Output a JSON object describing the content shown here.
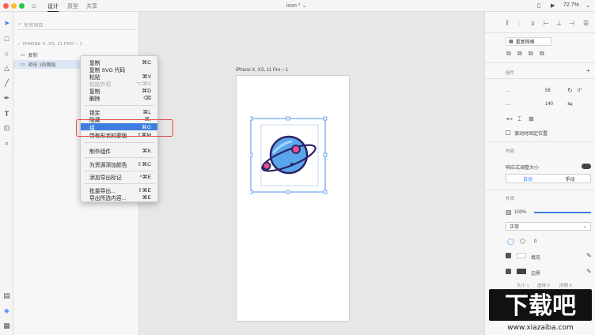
{
  "title_bar": {
    "tabs": [
      "设计",
      "原型",
      "共享"
    ],
    "doc_title": "icon *",
    "zoom": "72.7%"
  },
  "layers": {
    "search_placeholder": "所有项目",
    "artboard_name": "IPHONE X, XS, 11 PRO – 1",
    "items": [
      "复制",
      "矩形 1的图层"
    ]
  },
  "canvas": {
    "artboard_label": "iPhone X, XS, 11 Pro – 1"
  },
  "context_menu": {
    "items": [
      {
        "label": "复制",
        "shortcut": "⌘C",
        "state": "normal"
      },
      {
        "label": "复制 SVG 代码",
        "shortcut": "",
        "state": "normal"
      },
      {
        "label": "粘贴",
        "shortcut": "⌘V",
        "state": "normal"
      },
      {
        "label": "粘贴外观",
        "shortcut": "⌥⌘V",
        "state": "disabled"
      },
      {
        "label": "复制",
        "shortcut": "⌘D",
        "state": "normal"
      },
      {
        "label": "删除",
        "shortcut": "⌫",
        "state": "normal"
      },
      {
        "label": "锁定",
        "shortcut": "⌘L",
        "state": "normal"
      },
      {
        "label": "隐藏",
        "shortcut": "⌘,",
        "state": "normal"
      },
      {
        "label": "组",
        "shortcut": "⌘G",
        "state": "highlighted"
      },
      {
        "label": "带有形状的蒙版",
        "shortcut": "⇧⌘M",
        "state": "normal"
      },
      {
        "label": "制作组件",
        "shortcut": "⌘K",
        "state": "normal"
      },
      {
        "label": "为资源添加颜色",
        "shortcut": "⇧⌘C",
        "state": "normal"
      },
      {
        "label": "添加导出标记",
        "shortcut": "^⌘E",
        "state": "normal"
      },
      {
        "label": "批量导出...",
        "shortcut": "⇧⌘E",
        "state": "normal"
      },
      {
        "label": "导出所选内容...",
        "shortcut": "⌘E",
        "state": "normal"
      }
    ]
  },
  "right_panel": {
    "repeat_grid": "重复网格",
    "components_label": "组件",
    "w": "58",
    "h": "140",
    "rotation": "0°",
    "scroll_fixed": "滚动时固定位置",
    "layout_label": "布局",
    "responsive": "响应式调整大小",
    "auto": "自动",
    "manual": "手动",
    "appearance_label": "外观",
    "opacity": "100%",
    "blend": "正常",
    "radius": "0",
    "fill": "填充",
    "border": "边界",
    "size_label": "大小",
    "size_val": "1",
    "dash_label": "虚线",
    "dash_val": "0",
    "gap_label": "间隙",
    "gap_val": "0"
  },
  "watermark": {
    "logo": "下载吧",
    "url": "www.xiazaiba.com"
  },
  "colors": {
    "accent": "#3f7ee0",
    "highlight_box": "#e5483b",
    "planet": "#5aa6ec",
    "planet_outline": "#2c2266",
    "ring_dot": "#e0508a"
  }
}
